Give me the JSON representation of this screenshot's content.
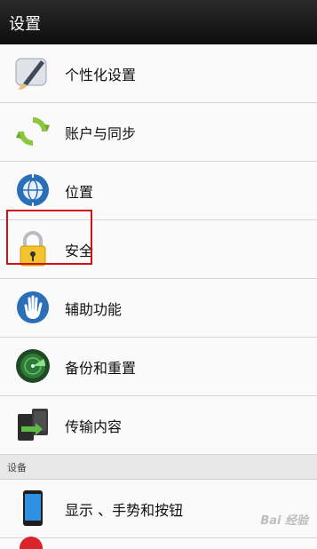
{
  "header": {
    "title": "设置"
  },
  "items": [
    {
      "label": "个性化设置",
      "icon": "paintbrush-icon"
    },
    {
      "label": "账户与同步",
      "icon": "sync-icon"
    },
    {
      "label": "位置",
      "icon": "globe-location-icon"
    },
    {
      "label": "安全",
      "icon": "lock-icon"
    },
    {
      "label": "辅助功能",
      "icon": "hand-icon"
    },
    {
      "label": "备份和重置",
      "icon": "radar-backup-icon"
    },
    {
      "label": "传输内容",
      "icon": "transfer-phone-icon"
    }
  ],
  "section": {
    "label": "设备"
  },
  "device_items": [
    {
      "label": "显示 、手势和按钮",
      "icon": "phone-icon"
    }
  ],
  "watermark": "Bai 经验",
  "colors": {
    "highlight": "#d01212",
    "topbar": "#141414"
  }
}
